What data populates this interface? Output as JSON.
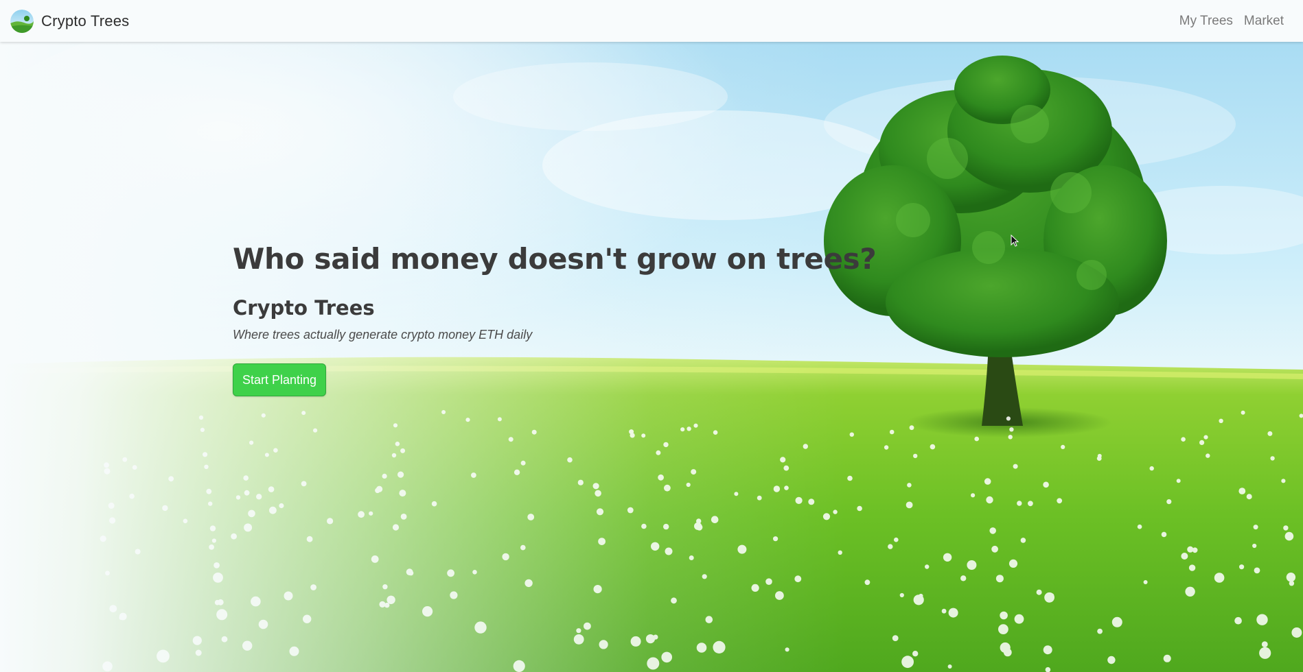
{
  "navbar": {
    "brand_name": "Crypto Trees",
    "links": [
      {
        "label": "My Trees"
      },
      {
        "label": "Market"
      }
    ]
  },
  "hero": {
    "title": "Who said money doesn't grow on trees?",
    "subtitle": "Crypto Trees",
    "tagline": "Where trees actually generate crypto money ETH daily",
    "cta_label": "Start Planting"
  },
  "colors": {
    "cta_background": "#3fd14a",
    "sky": "#bfe6f7",
    "grass": "#6fc22a",
    "tree": "#2f8a1e"
  },
  "icons": {
    "brand_logo": "landscape-globe-icon",
    "cursor": "mouse-pointer-icon"
  }
}
